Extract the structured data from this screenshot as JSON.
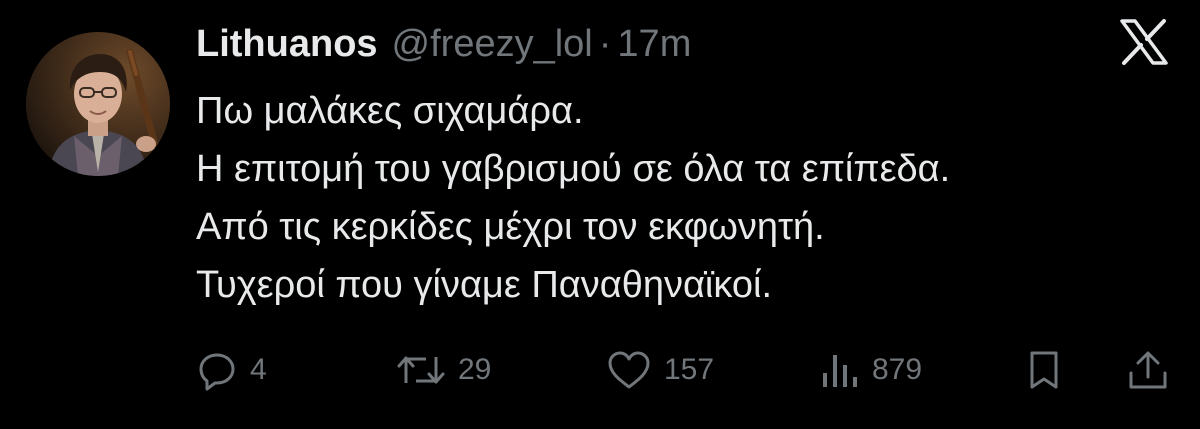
{
  "author": {
    "display_name": "Lithuanos",
    "handle": "@freezy_lol",
    "separator": "·",
    "time": "17m"
  },
  "brand": {
    "logo_icon": "x-logo-icon"
  },
  "tweet": {
    "lines": [
      "Πω μαλάκες σιχαμάρα.",
      "Η επιτομή του γαβρισμού σε όλα τα επίπεδα.",
      "Από τις κερκίδες μέχρι τον εκφωνητή.",
      "Τυχεροί που γίναμε Παναθηναϊκοί."
    ]
  },
  "actions": {
    "reply_count": "4",
    "retweet_count": "29",
    "like_count": "157",
    "views_count": "879",
    "icons": [
      "reply-icon",
      "retweet-icon",
      "like-icon",
      "views-icon",
      "bookmark-icon",
      "share-icon"
    ]
  },
  "colors": {
    "background": "#000000",
    "primary_text": "#e7e9ea",
    "secondary_text": "#71767b"
  }
}
